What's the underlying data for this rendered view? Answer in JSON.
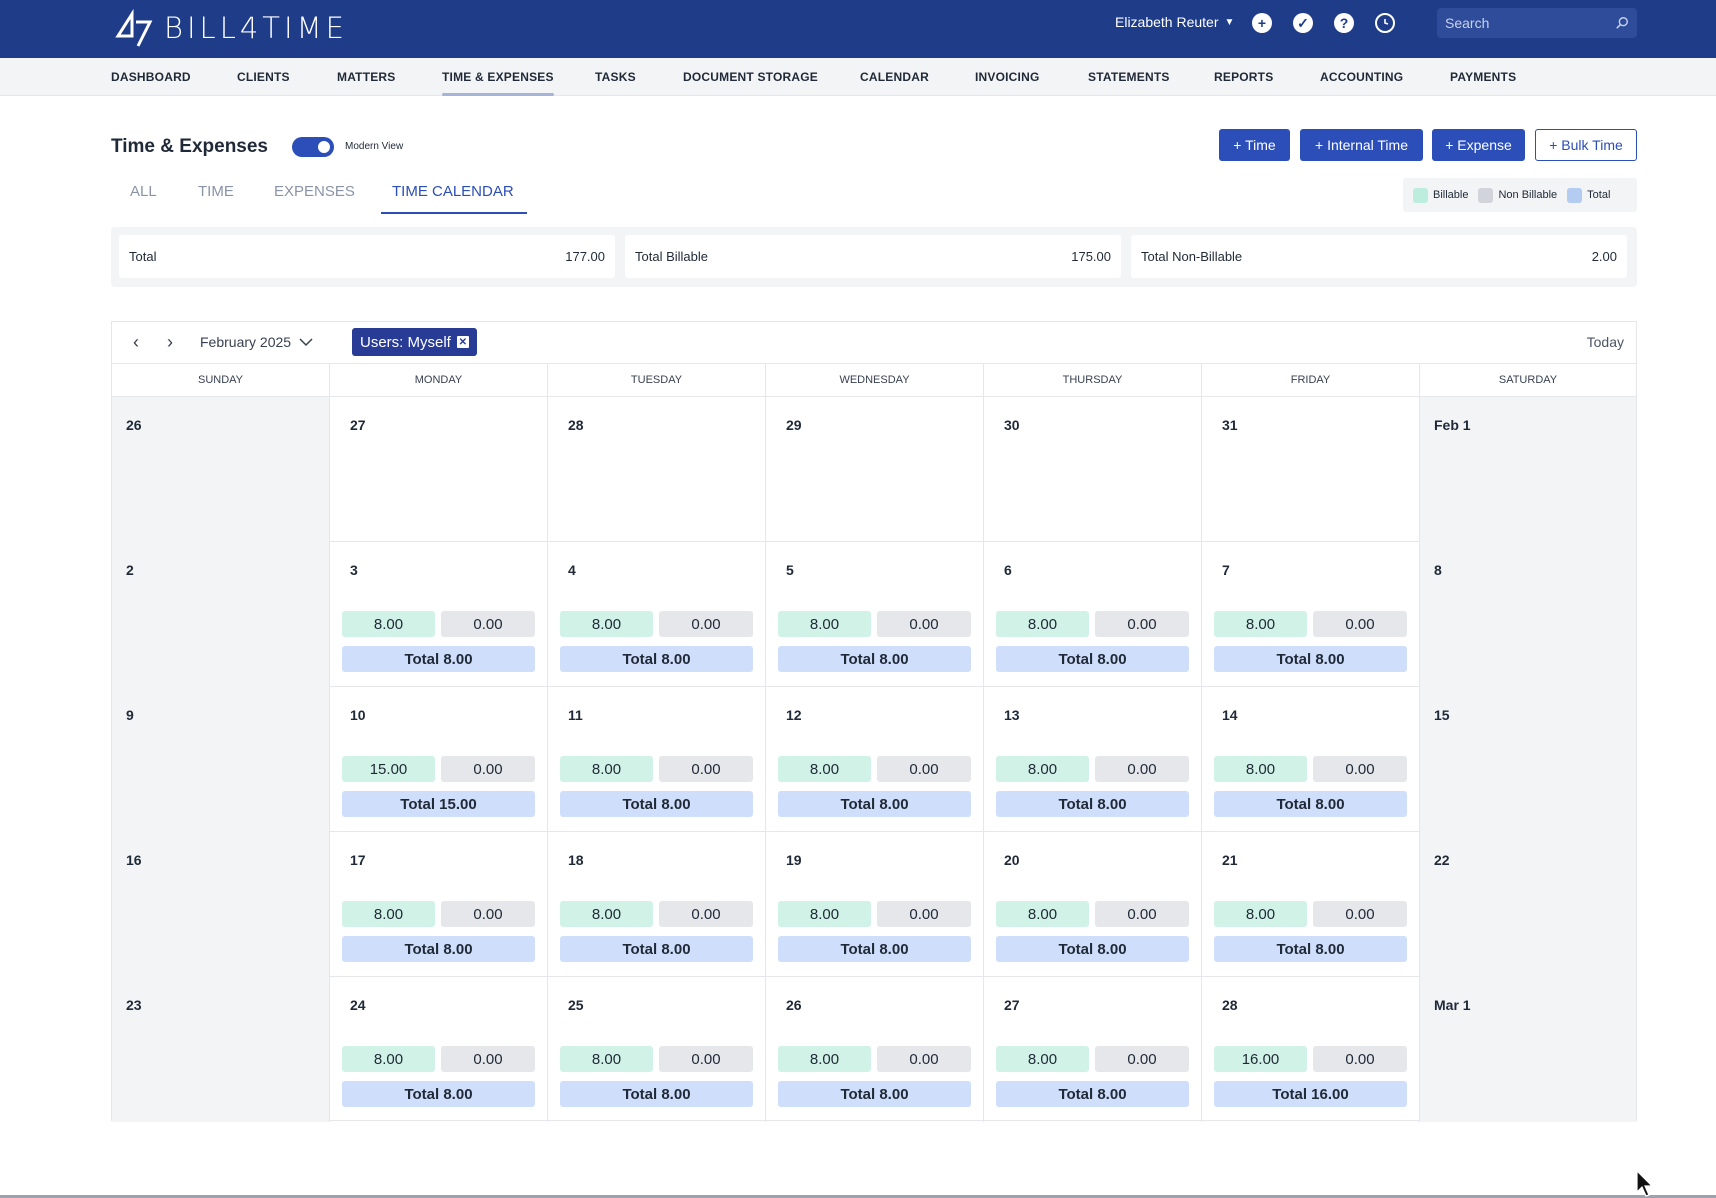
{
  "header": {
    "logo_text": "BILL4TIME",
    "user_name": "Elizabeth Reuter",
    "search_placeholder": "Search"
  },
  "nav": [
    "DASHBOARD",
    "CLIENTS",
    "MATTERS",
    "TIME & EXPENSES",
    "TASKS",
    "DOCUMENT STORAGE",
    "CALENDAR",
    "INVOICING",
    "STATEMENTS",
    "REPORTS",
    "ACCOUNTING",
    "PAYMENTS"
  ],
  "page": {
    "title": "Time & Expenses",
    "toggle_label": "Modern View",
    "buttons": [
      "+ Time",
      "+ Internal Time",
      "+ Expense",
      "+ Bulk Time"
    ]
  },
  "tabs": [
    "ALL",
    "TIME",
    "EXPENSES",
    "TIME CALENDAR"
  ],
  "legend": [
    "Billable",
    "Non Billable",
    "Total"
  ],
  "summary": [
    {
      "label": "Total",
      "value": "177.00"
    },
    {
      "label": "Total Billable",
      "value": "175.00"
    },
    {
      "label": "Total Non-Billable",
      "value": "2.00"
    }
  ],
  "calendar": {
    "month_label": "February 2025",
    "filter_chip": "Users: Myself",
    "today_label": "Today",
    "weekdays": [
      "SUNDAY",
      "MONDAY",
      "TUESDAY",
      "WEDNESDAY",
      "THURSDAY",
      "FRIDAY",
      "SATURDAY"
    ],
    "weeks": [
      [
        {
          "d": "26"
        },
        {
          "d": "27"
        },
        {
          "d": "28"
        },
        {
          "d": "29"
        },
        {
          "d": "30"
        },
        {
          "d": "31"
        },
        {
          "d": "Feb 1"
        }
      ],
      [
        {
          "d": "2"
        },
        {
          "d": "3",
          "b": "8.00",
          "n": "0.00",
          "t": "Total 8.00"
        },
        {
          "d": "4",
          "b": "8.00",
          "n": "0.00",
          "t": "Total 8.00"
        },
        {
          "d": "5",
          "b": "8.00",
          "n": "0.00",
          "t": "Total 8.00"
        },
        {
          "d": "6",
          "b": "8.00",
          "n": "0.00",
          "t": "Total 8.00"
        },
        {
          "d": "7",
          "b": "8.00",
          "n": "0.00",
          "t": "Total 8.00"
        },
        {
          "d": "8"
        }
      ],
      [
        {
          "d": "9"
        },
        {
          "d": "10",
          "b": "15.00",
          "n": "0.00",
          "t": "Total 15.00"
        },
        {
          "d": "11",
          "b": "8.00",
          "n": "0.00",
          "t": "Total 8.00"
        },
        {
          "d": "12",
          "b": "8.00",
          "n": "0.00",
          "t": "Total 8.00"
        },
        {
          "d": "13",
          "b": "8.00",
          "n": "0.00",
          "t": "Total 8.00"
        },
        {
          "d": "14",
          "b": "8.00",
          "n": "0.00",
          "t": "Total 8.00"
        },
        {
          "d": "15"
        }
      ],
      [
        {
          "d": "16"
        },
        {
          "d": "17",
          "b": "8.00",
          "n": "0.00",
          "t": "Total 8.00"
        },
        {
          "d": "18",
          "b": "8.00",
          "n": "0.00",
          "t": "Total 8.00"
        },
        {
          "d": "19",
          "b": "8.00",
          "n": "0.00",
          "t": "Total 8.00"
        },
        {
          "d": "20",
          "b": "8.00",
          "n": "0.00",
          "t": "Total 8.00"
        },
        {
          "d": "21",
          "b": "8.00",
          "n": "0.00",
          "t": "Total 8.00"
        },
        {
          "d": "22"
        }
      ],
      [
        {
          "d": "23"
        },
        {
          "d": "24",
          "b": "8.00",
          "n": "0.00",
          "t": "Total 8.00"
        },
        {
          "d": "25",
          "b": "8.00",
          "n": "0.00",
          "t": "Total 8.00"
        },
        {
          "d": "26",
          "b": "8.00",
          "n": "0.00",
          "t": "Total 8.00"
        },
        {
          "d": "27",
          "b": "8.00",
          "n": "0.00",
          "t": "Total 8.00"
        },
        {
          "d": "28",
          "b": "16.00",
          "n": "0.00",
          "t": "Total 16.00"
        },
        {
          "d": "Mar 1"
        }
      ]
    ]
  },
  "colors": {
    "brand": "#1f3c88",
    "accent": "#2b4eb8",
    "billable": "#d1f2e6",
    "non_billable": "#e5e7eb",
    "total": "#cfdefa"
  }
}
